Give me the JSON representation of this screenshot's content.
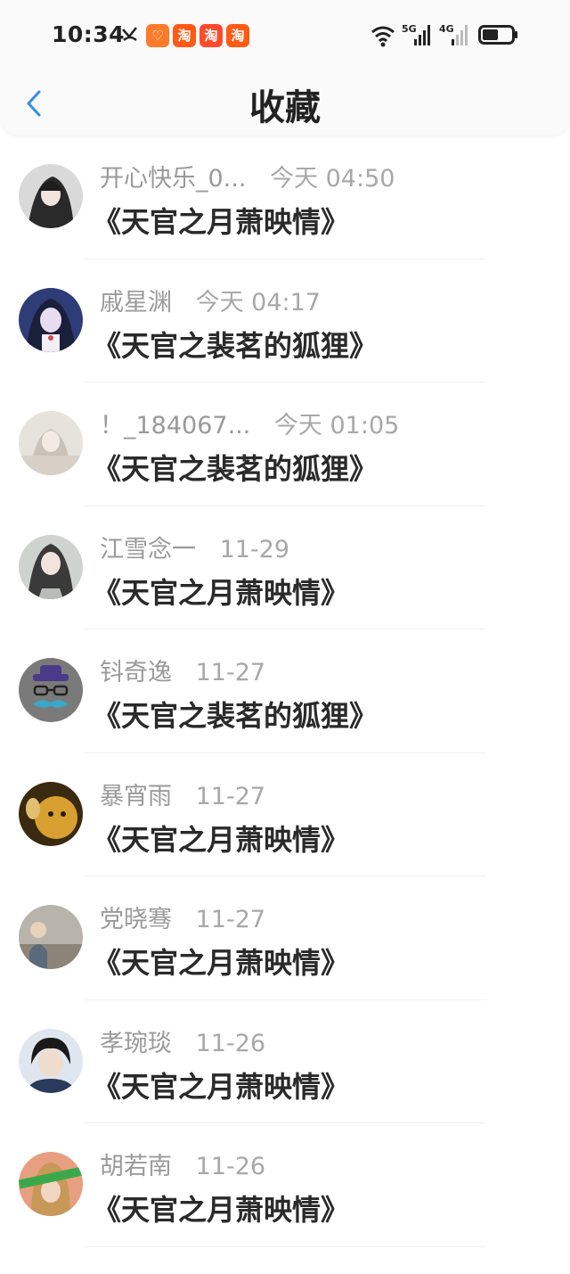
{
  "status_bar": {
    "time": "10:34",
    "badges": [
      "♡",
      "淘",
      "淘",
      "淘"
    ],
    "network_labels": [
      "5G",
      "4G"
    ]
  },
  "nav": {
    "title": "收藏",
    "back_icon": "chevron-left-icon"
  },
  "colors": {
    "accent": "#2f8fe6",
    "name": "#9a9a9a",
    "title": "#2a2a2a"
  },
  "favorites": [
    {
      "user": "开心快乐_0...",
      "time": "今天 04:50",
      "book": "《天官之月萧映情》"
    },
    {
      "user": "戚星渊",
      "time": "今天 04:17",
      "book": "《天官之裴茗的狐狸》"
    },
    {
      "user": "！_184067...",
      "time": "今天 01:05",
      "book": "《天官之裴茗的狐狸》"
    },
    {
      "user": "江雪念一",
      "time": "11-29",
      "book": "《天官之月萧映情》"
    },
    {
      "user": "钭奇逸",
      "time": "11-27",
      "book": "《天官之裴茗的狐狸》"
    },
    {
      "user": "暴宵雨",
      "time": "11-27",
      "book": "《天官之月萧映情》"
    },
    {
      "user": "党晓骞",
      "time": "11-27",
      "book": "《天官之月萧映情》"
    },
    {
      "user": "孝琬琰",
      "time": "11-26",
      "book": "《天官之月萧映情》"
    },
    {
      "user": "胡若南",
      "time": "11-26",
      "book": "《天官之月萧映情》"
    }
  ]
}
